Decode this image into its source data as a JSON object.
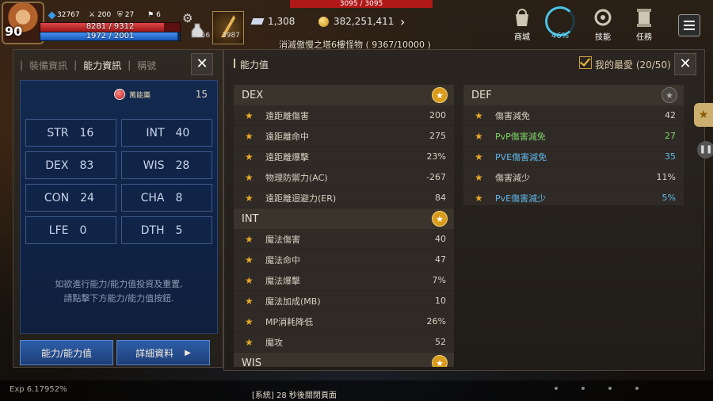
{
  "hud": {
    "level": "90",
    "crystal_small": "32767",
    "stat_a": "200",
    "stat_b": "27",
    "stat_c": "6",
    "hp": "8281 / 9312",
    "hp_fraction": 0.889,
    "mp": "1972 / 2001",
    "mp_fraction": 0.985,
    "potion_count": "856",
    "slot_count": "3987",
    "target_hp": "3095 / 3095",
    "crystals": "1,308",
    "gold": "382,251,411",
    "quest": "消滅傲慢之塔6樓怪物 ( 9367/10000 )",
    "buttons": [
      {
        "label": "商城",
        "icon": "shop-bag-icon"
      },
      {
        "label": "46%",
        "icon": "weight-ring-icon"
      },
      {
        "label": "技能",
        "icon": "skill-icon"
      },
      {
        "label": "任務",
        "icon": "quest-scroll-icon"
      }
    ],
    "weight_pct": 0.46
  },
  "left_panel": {
    "tabs": [
      "裝備資訊",
      "能力資訊",
      "稱號"
    ],
    "active_tab": 1,
    "potion_label": "萬能藥",
    "potion_value": "15",
    "attributes": [
      {
        "name": "STR",
        "value": "16"
      },
      {
        "name": "INT",
        "value": "40"
      },
      {
        "name": "DEX",
        "value": "83"
      },
      {
        "name": "WIS",
        "value": "28"
      },
      {
        "name": "CON",
        "value": "24"
      },
      {
        "name": "CHA",
        "value": "8"
      },
      {
        "name": "LFE",
        "value": "0"
      },
      {
        "name": "DTH",
        "value": "5"
      }
    ],
    "hint_line1": "如欲進行能力/能力值投資及重置,",
    "hint_line2": "請點擊下方能力/能力值按鈕.",
    "button_stats": "能力/能力值",
    "button_details": "詳細資料",
    "close": "✕"
  },
  "right_panel": {
    "title": "能力值",
    "favorites": "我的最愛 (20/50)",
    "close": "✕",
    "dex": {
      "header": "DEX",
      "rows": [
        {
          "name": "遠距離傷害",
          "value": "200",
          "color": ""
        },
        {
          "name": "遠距離命中",
          "value": "275",
          "color": ""
        },
        {
          "name": "遠距離爆擊",
          "value": "23%",
          "color": ""
        },
        {
          "name": "物理防禦力(AC)",
          "value": "-267",
          "color": ""
        },
        {
          "name": "遠距離迴避力(ER)",
          "value": "84",
          "color": ""
        }
      ]
    },
    "int": {
      "header": "INT",
      "rows": [
        {
          "name": "魔法傷害",
          "value": "40",
          "color": ""
        },
        {
          "name": "魔法命中",
          "value": "47",
          "color": ""
        },
        {
          "name": "魔法爆擊",
          "value": "7%",
          "color": ""
        },
        {
          "name": "魔法加成(MB)",
          "value": "10",
          "color": ""
        },
        {
          "name": "MP消耗降低",
          "value": "26%",
          "color": ""
        },
        {
          "name": "魔攻",
          "value": "52",
          "color": ""
        }
      ]
    },
    "wis": {
      "header": "WIS"
    },
    "def": {
      "header": "DEF",
      "rows": [
        {
          "name": "傷害減免",
          "value": "42",
          "color": ""
        },
        {
          "name": "PvP傷害減免",
          "value": "27",
          "color": "green"
        },
        {
          "name": "PVE傷害減免",
          "value": "35",
          "color": "blue"
        },
        {
          "name": "傷害減少",
          "value": "11%",
          "color": ""
        },
        {
          "name": "PvE傷害減少",
          "value": "5%",
          "color": "blue"
        }
      ]
    }
  },
  "bottom": {
    "exp": "Exp  6.17952%",
    "system_message": "[系統] 28 秒後關閉頁面"
  },
  "icons": {
    "star": "★",
    "arrow": "›",
    "gear": "⚙"
  }
}
